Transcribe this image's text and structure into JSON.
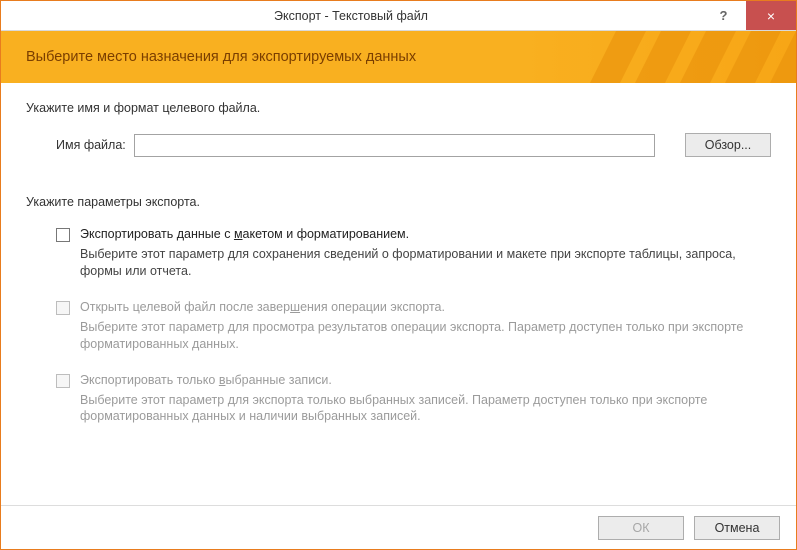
{
  "titlebar": {
    "title": "Экспорт - Текстовый файл",
    "help": "?",
    "close": "×"
  },
  "banner": {
    "heading": "Выберите место назначения для экспортируемых данных"
  },
  "destination": {
    "section_label": "Укажите имя и формат целевого файла.",
    "file_label": "Имя файла:",
    "file_value": "",
    "browse": "Обзор..."
  },
  "params": {
    "section_label": "Укажите параметры экспорта.",
    "options": [
      {
        "title_pre": "Экспортировать данные с ",
        "title_u": "м",
        "title_post": "акетом и форматированием.",
        "desc": "Выберите этот параметр для сохранения сведений о форматировании и макете при экспорте таблицы, запроса, формы или отчета.",
        "disabled": false
      },
      {
        "title_pre": "Открыть целевой файл после завер",
        "title_u": "ш",
        "title_post": "ения операции экспорта.",
        "desc": "Выберите этот параметр для просмотра результатов операции экспорта. Параметр доступен только при экспорте форматированных данных.",
        "disabled": true
      },
      {
        "title_pre": "Экспортировать только ",
        "title_u": "в",
        "title_post": "ыбранные записи.",
        "desc": "Выберите этот параметр для экспорта только выбранных записей. Параметр доступен только при экспорте форматированных данных и наличии выбранных записей.",
        "disabled": true
      }
    ]
  },
  "footer": {
    "ok": "ОК",
    "cancel": "Отмена"
  }
}
